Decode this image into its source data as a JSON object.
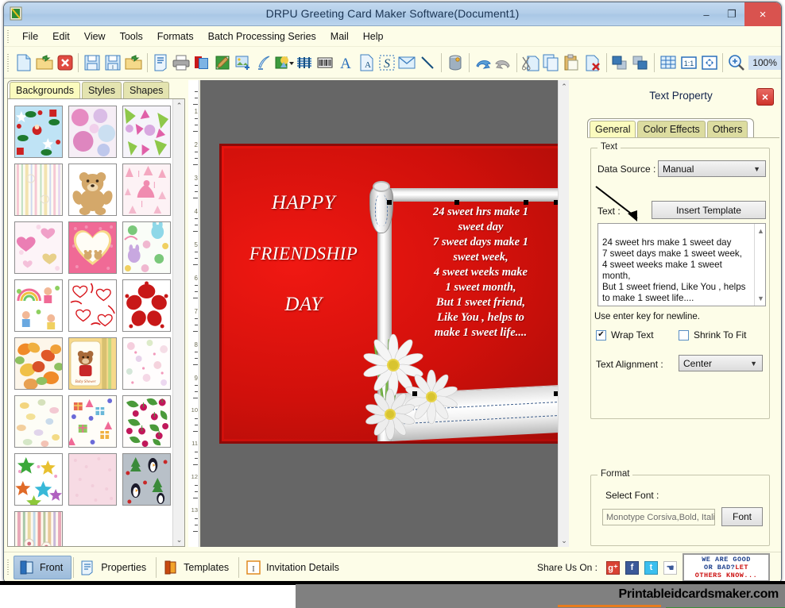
{
  "window": {
    "title": "DRPU Greeting Card Maker Software(Document1)",
    "app_icon": "app-icon",
    "minimize": "–",
    "maximize": "❐",
    "close": "×"
  },
  "menu": {
    "items": [
      {
        "label": "File"
      },
      {
        "label": "Edit"
      },
      {
        "label": "View"
      },
      {
        "label": "Tools"
      },
      {
        "label": "Formats"
      },
      {
        "label": "Batch Processing Series"
      },
      {
        "label": "Mail"
      },
      {
        "label": "Help"
      }
    ]
  },
  "toolbar": {
    "zoom_value": "100%",
    "buttons": [
      {
        "name": "new-document-icon"
      },
      {
        "name": "open-folder-icon"
      },
      {
        "name": "close-document-icon"
      },
      {
        "name": "save-icon"
      },
      {
        "name": "save-as-icon"
      },
      {
        "name": "open-template-icon"
      },
      {
        "name": "document-properties-icon"
      },
      {
        "name": "print-icon"
      },
      {
        "name": "card-layers-icon"
      },
      {
        "name": "paint-design-icon"
      },
      {
        "name": "insert-image-icon"
      },
      {
        "name": "insert-pen-icon"
      },
      {
        "name": "insert-shape-icon"
      },
      {
        "name": "barcode-lines-icon"
      },
      {
        "name": "barcode-icon"
      },
      {
        "name": "insert-text-icon"
      },
      {
        "name": "text-box-icon"
      },
      {
        "name": "signature-icon"
      },
      {
        "name": "envelope-icon"
      },
      {
        "name": "line-tool-icon"
      },
      {
        "name": "database-icon"
      },
      {
        "name": "undo-icon"
      },
      {
        "name": "redo-icon"
      },
      {
        "name": "cut-icon"
      },
      {
        "name": "copy-icon"
      },
      {
        "name": "paste-icon"
      },
      {
        "name": "delete-icon"
      },
      {
        "name": "bring-to-front-icon"
      },
      {
        "name": "send-to-back-icon"
      },
      {
        "name": "grid-icon"
      },
      {
        "name": "actual-size-icon"
      },
      {
        "name": "fit-to-window-icon"
      },
      {
        "name": "zoom-in-icon"
      }
    ]
  },
  "left_panel": {
    "tabs": [
      {
        "label": "Backgrounds",
        "active": true
      },
      {
        "label": "Styles",
        "active": false
      },
      {
        "label": "Shapes",
        "active": false
      }
    ],
    "scroll_up": "⌃",
    "scroll_down": "⌄",
    "thumbnails": [
      {
        "name": "thumb-christmas-santa"
      },
      {
        "name": "thumb-pink-pompoms"
      },
      {
        "name": "thumb-pink-green-floral"
      },
      {
        "name": "thumb-pastel-stripes"
      },
      {
        "name": "thumb-teddy-bear"
      },
      {
        "name": "thumb-pink-princess"
      },
      {
        "name": "thumb-pink-hearts"
      },
      {
        "name": "thumb-heart-frame-bears"
      },
      {
        "name": "thumb-bunny-pattern"
      },
      {
        "name": "thumb-kids-rainbow"
      },
      {
        "name": "thumb-white-hearts-ribbons"
      },
      {
        "name": "thumb-red-hibiscus"
      },
      {
        "name": "thumb-orange-butterflies"
      },
      {
        "name": "thumb-baby-shower-bear"
      },
      {
        "name": "thumb-pink-confetti"
      },
      {
        "name": "thumb-pastel-speckle"
      },
      {
        "name": "thumb-gift-party"
      },
      {
        "name": "thumb-cherries-leaves"
      },
      {
        "name": "thumb-colored-stars"
      },
      {
        "name": "thumb-plain-pink"
      },
      {
        "name": "thumb-winter-penguins"
      },
      {
        "name": "thumb-vertical-stripes"
      }
    ]
  },
  "canvas": {
    "ruler_numbers": [
      1,
      2,
      3,
      4,
      5,
      6,
      7,
      8,
      9,
      10,
      11,
      12,
      13
    ],
    "card": {
      "title_lines": [
        "HAPPY",
        "FRIENDSHIP",
        "DAY"
      ],
      "body_text": "24 sweet hrs make 1\nsweet day\n7 sweet days make 1\nsweet week,\n4 sweet weeks make\n1 sweet month,\nBut 1 sweet friend,\nLike You , helps to\nmake 1 sweet life...."
    },
    "scroll_up": "⌃",
    "scroll_down": "⌄"
  },
  "right_panel": {
    "title": "Text Property",
    "close": "×",
    "tabs": [
      {
        "label": "General",
        "active": true
      },
      {
        "label": "Color Effects",
        "active": false
      },
      {
        "label": "Others",
        "active": false
      }
    ],
    "text_group": {
      "legend": "Text",
      "data_source_label": "Data Source :",
      "data_source_value": "Manual",
      "text_label": "Text :",
      "insert_template_label": "Insert Template",
      "textarea_value": "24 sweet hrs make 1 sweet day\n7 sweet days make 1 sweet week,\n4 sweet weeks make 1 sweet\nmonth,\nBut 1 sweet friend, Like You , helps\nto make 1 sweet life....",
      "hint": "Use enter key for newline.",
      "wrap_text_label": "Wrap Text",
      "wrap_text_checked": "✔",
      "shrink_to_fit_label": "Shrink To Fit",
      "shrink_to_fit_checked": "",
      "alignment_label": "Text Alignment :",
      "alignment_value": "Center"
    },
    "format_group": {
      "legend": "Format",
      "select_font_label": "Select Font :",
      "font_value": "Monotype Corsiva,Bold, Italic",
      "font_button_label": "Font"
    }
  },
  "bottom_bar": {
    "items": [
      {
        "label": "Front",
        "icon": "front-card-icon",
        "active": true
      },
      {
        "label": "Properties",
        "icon": "properties-icon",
        "active": false
      },
      {
        "label": "Templates",
        "icon": "templates-icon",
        "active": false
      },
      {
        "label": "Invitation Details",
        "icon": "invitation-details-icon",
        "active": false
      }
    ],
    "share_label": "Share Us On :",
    "social": [
      {
        "name": "google-plus-icon",
        "glyph": "g⁺"
      },
      {
        "name": "facebook-icon",
        "glyph": "f"
      },
      {
        "name": "twitter-icon",
        "glyph": "t"
      },
      {
        "name": "thumbs-up-icon",
        "glyph": "☚"
      }
    ],
    "feedback": {
      "line1": "WE ARE GOOD",
      "line2_pre": "OR BAD?",
      "line2_red": "LET",
      "line3": "OTHERS KNOW..."
    }
  },
  "footer": {
    "site": "Printableidcardsmaker.com"
  }
}
